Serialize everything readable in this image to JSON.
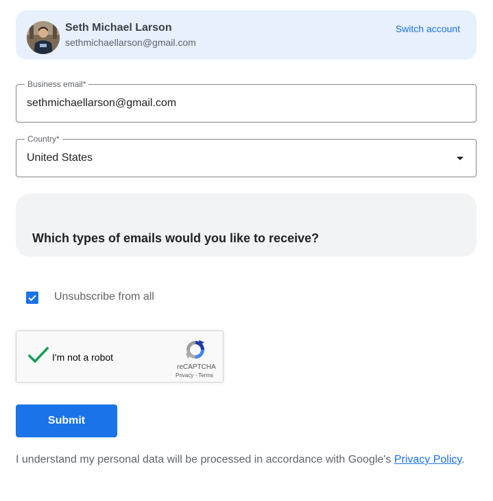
{
  "account": {
    "name": "Seth Michael Larson",
    "email": "sethmichaellarson@gmail.com",
    "switch_label": "Switch account"
  },
  "form": {
    "email_field": {
      "label": "Business email*",
      "value": "sethmichaellarson@gmail.com"
    },
    "country_field": {
      "label": "Country*",
      "value": "United States"
    },
    "question": "Which types of emails would you like to receive?",
    "unsubscribe": {
      "label": "Unsubscribe from all",
      "checked": true
    }
  },
  "recaptcha": {
    "label": "I'm not a robot",
    "brand": "reCAPTCHA",
    "privacy": "Privacy",
    "separator": "-",
    "terms": "Terms",
    "verified": true
  },
  "submit": {
    "label": "Submit"
  },
  "disclaimer": {
    "text": "I understand my personal data will be processed in accordance with Google's ",
    "link_label": "Privacy Policy",
    "end": "."
  },
  "colors": {
    "accent": "#1a73e8",
    "card_bg": "#e8f0fe",
    "question_bg": "#f1f3f4",
    "check_green": "#0f9d58"
  },
  "icons": {
    "avatar": "user-avatar",
    "checkbox": "check-icon",
    "dropdown": "dropdown-arrow-icon",
    "recaptcha_check": "green-check-icon",
    "recaptcha_logo": "recaptcha-logo-icon"
  }
}
